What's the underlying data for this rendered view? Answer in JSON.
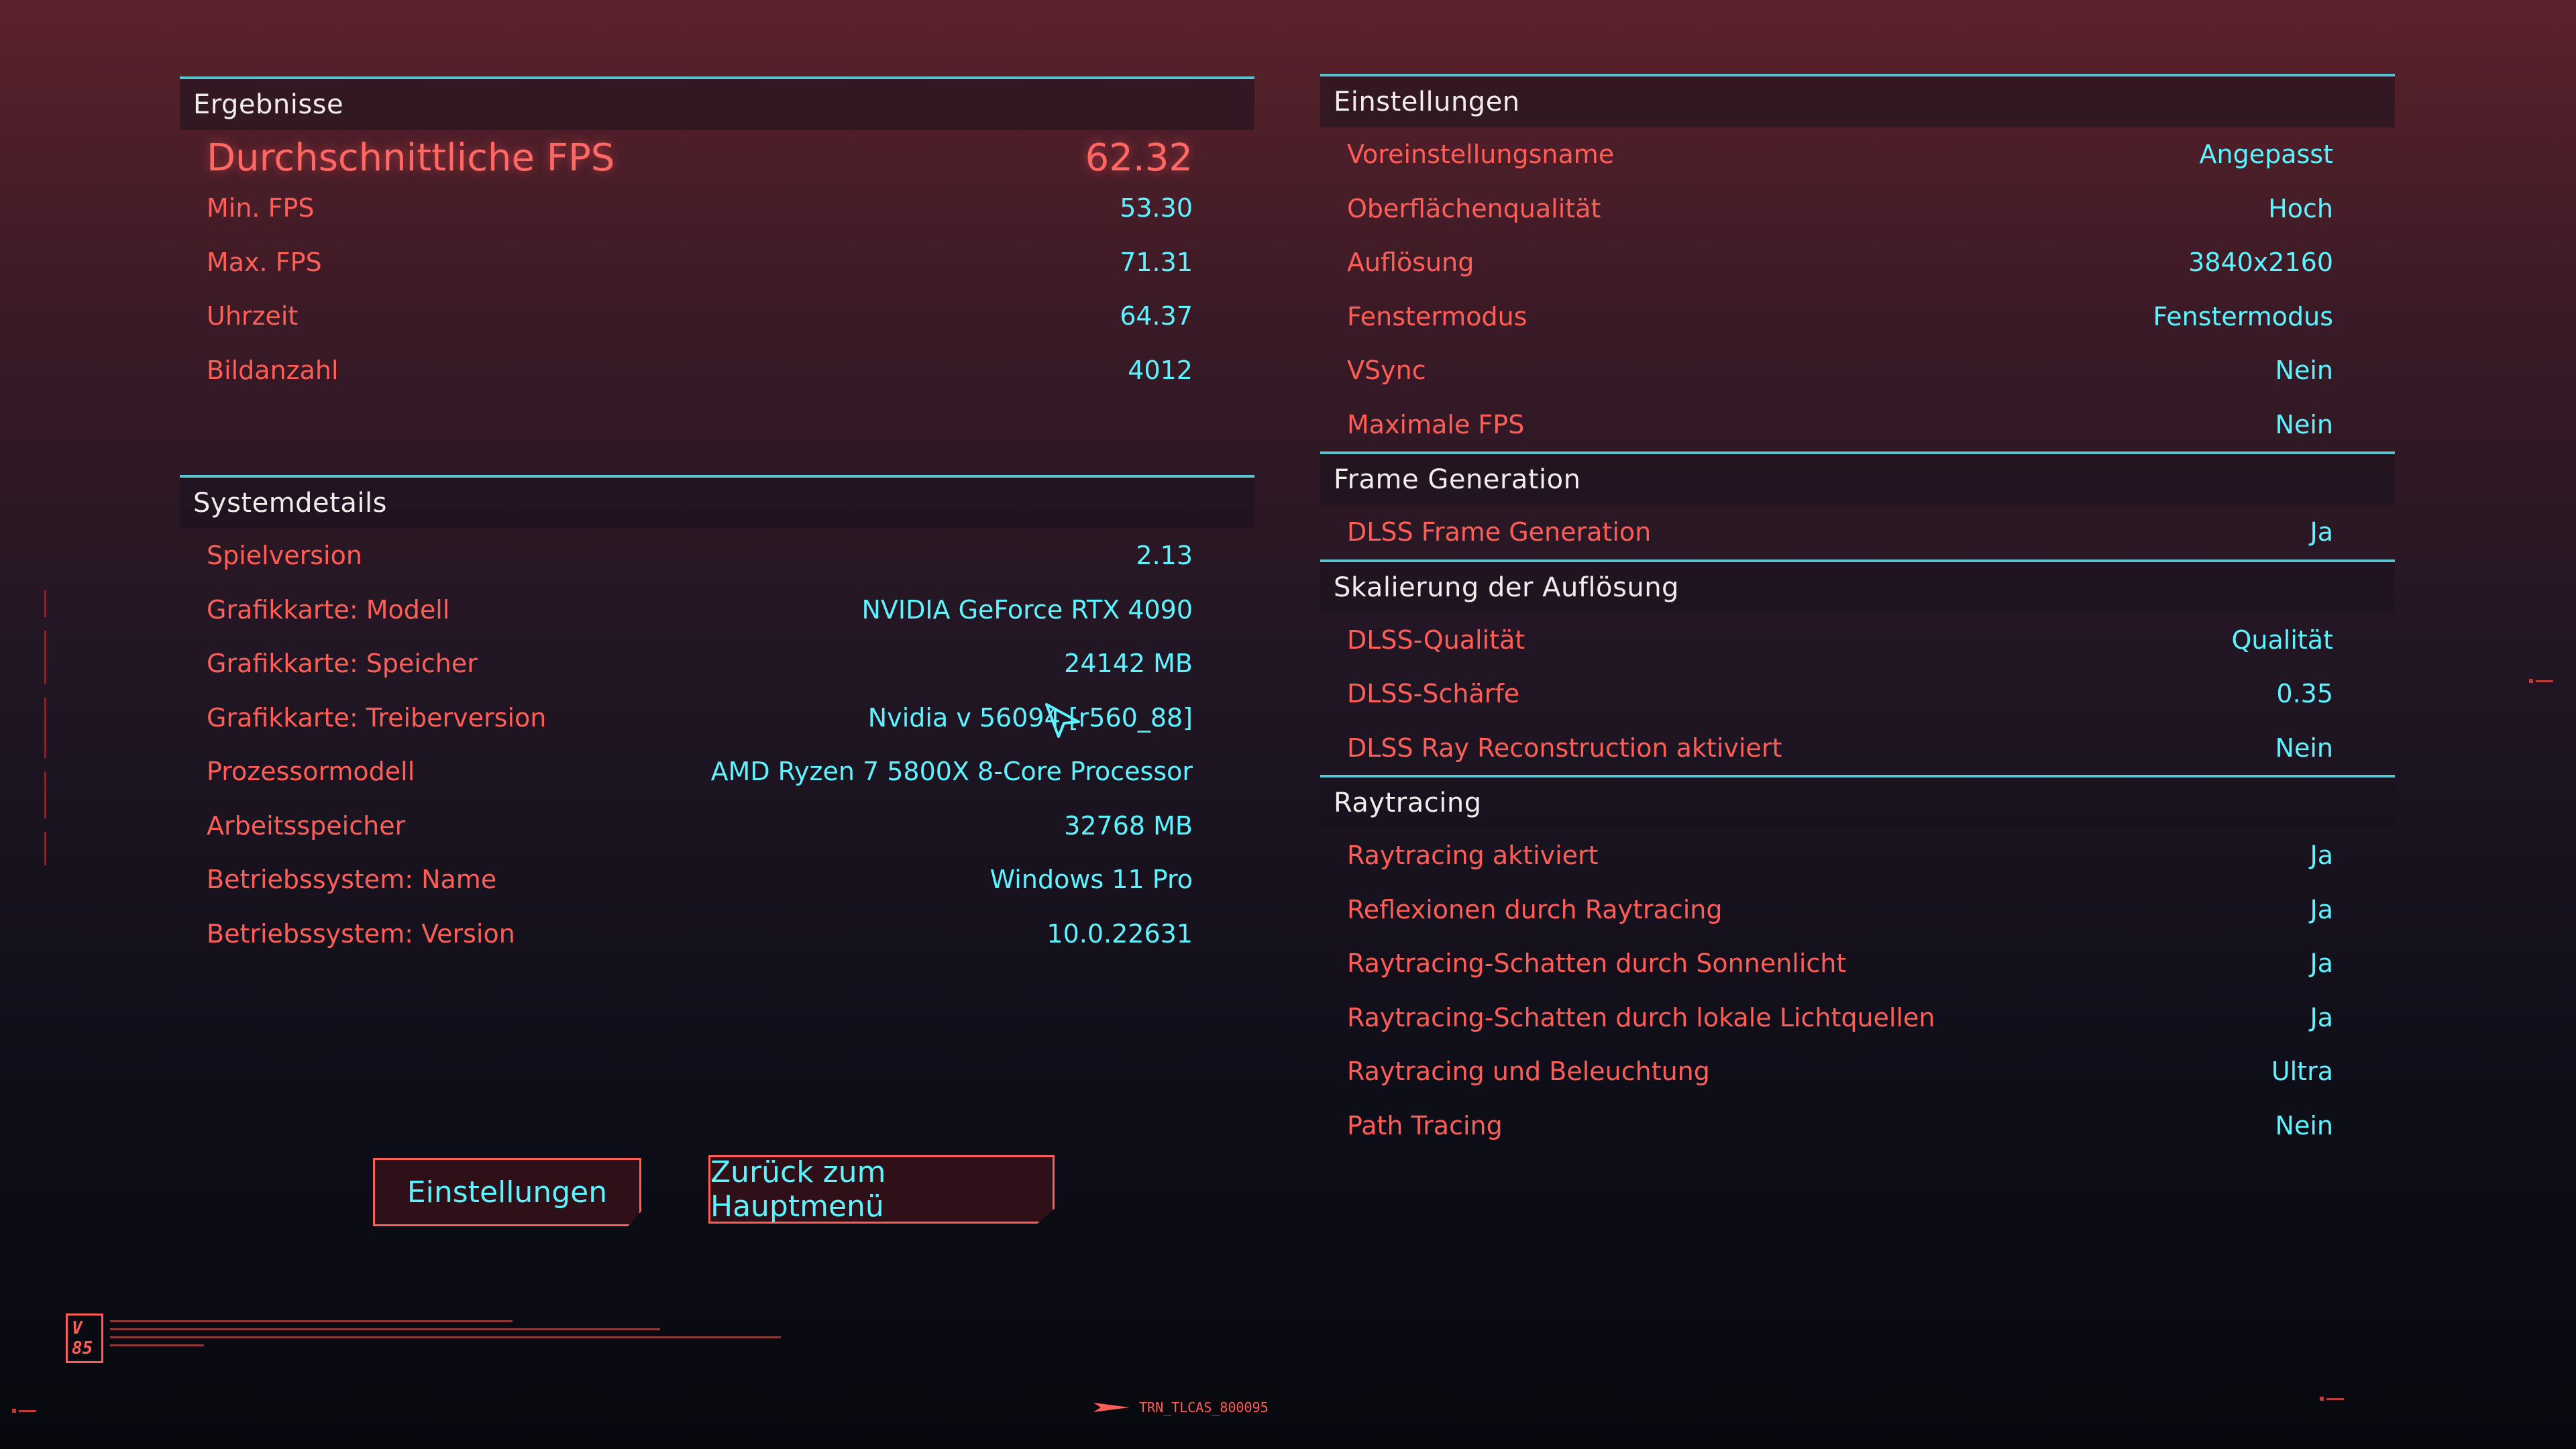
{
  "results": {
    "title": "Ergebnisse",
    "avg_fps": {
      "label": "Durchschnittliche FPS",
      "value": "62.32"
    },
    "rows": [
      {
        "label": "Min. FPS",
        "value": "53.30"
      },
      {
        "label": "Max. FPS",
        "value": "71.31"
      },
      {
        "label": "Uhrzeit",
        "value": "64.37"
      },
      {
        "label": "Bildanzahl",
        "value": "4012"
      }
    ]
  },
  "system": {
    "title": "Systemdetails",
    "rows": [
      {
        "label": "Spielversion",
        "value": "2.13"
      },
      {
        "label": "Grafikkarte: Modell",
        "value": "NVIDIA GeForce RTX 4090"
      },
      {
        "label": "Grafikkarte: Speicher",
        "value": "24142 MB"
      },
      {
        "label": "Grafikkarte: Treiberversion",
        "value": "Nvidia v 56094 [r560_88]"
      },
      {
        "label": "Prozessormodell",
        "value": "AMD Ryzen 7 5800X 8-Core Processor"
      },
      {
        "label": "Arbeitsspeicher",
        "value": "32768 MB"
      },
      {
        "label": "Betriebssystem: Name",
        "value": "Windows 11 Pro"
      },
      {
        "label": "Betriebssystem: Version",
        "value": "10.0.22631"
      }
    ]
  },
  "settings": {
    "title": "Einstellungen",
    "rows": [
      {
        "label": "Voreinstellungsname",
        "value": "Angepasst"
      },
      {
        "label": "Oberflächenqualität",
        "value": "Hoch"
      },
      {
        "label": "Auflösung",
        "value": "3840x2160"
      },
      {
        "label": "Fenstermodus",
        "value": "Fenstermodus"
      },
      {
        "label": "VSync",
        "value": "Nein"
      },
      {
        "label": "Maximale FPS",
        "value": "Nein"
      }
    ]
  },
  "frame_generation": {
    "title": "Frame Generation",
    "rows": [
      {
        "label": "DLSS Frame Generation",
        "value": "Ja"
      }
    ]
  },
  "scaling": {
    "title": "Skalierung der Auflösung",
    "rows": [
      {
        "label": "DLSS-Qualität",
        "value": "Qualität"
      },
      {
        "label": "DLSS-Schärfe",
        "value": "0.35"
      },
      {
        "label": "DLSS Ray Reconstruction aktiviert",
        "value": "Nein"
      }
    ]
  },
  "raytracing": {
    "title": "Raytracing",
    "rows": [
      {
        "label": "Raytracing aktiviert",
        "value": "Ja"
      },
      {
        "label": "Reflexionen durch Raytracing",
        "value": "Ja"
      },
      {
        "label": "Raytracing-Schatten durch Sonnenlicht",
        "value": "Ja"
      },
      {
        "label": "Raytracing-Schatten durch lokale Lichtquellen",
        "value": "Ja"
      },
      {
        "label": "Raytracing und Beleuchtung",
        "value": "Ultra"
      },
      {
        "label": "Path Tracing",
        "value": "Nein"
      }
    ]
  },
  "buttons": {
    "settings": "Einstellungen",
    "back": "Zurück zum Hauptmenü"
  },
  "footer": {
    "badge_line1": "V",
    "badge_line2": "85",
    "code": "TRN_TLCAS_800095"
  },
  "colors": {
    "accent_red": "#ff5e57",
    "accent_cyan": "#5ef4ff",
    "divider": "#5cc5d2"
  }
}
